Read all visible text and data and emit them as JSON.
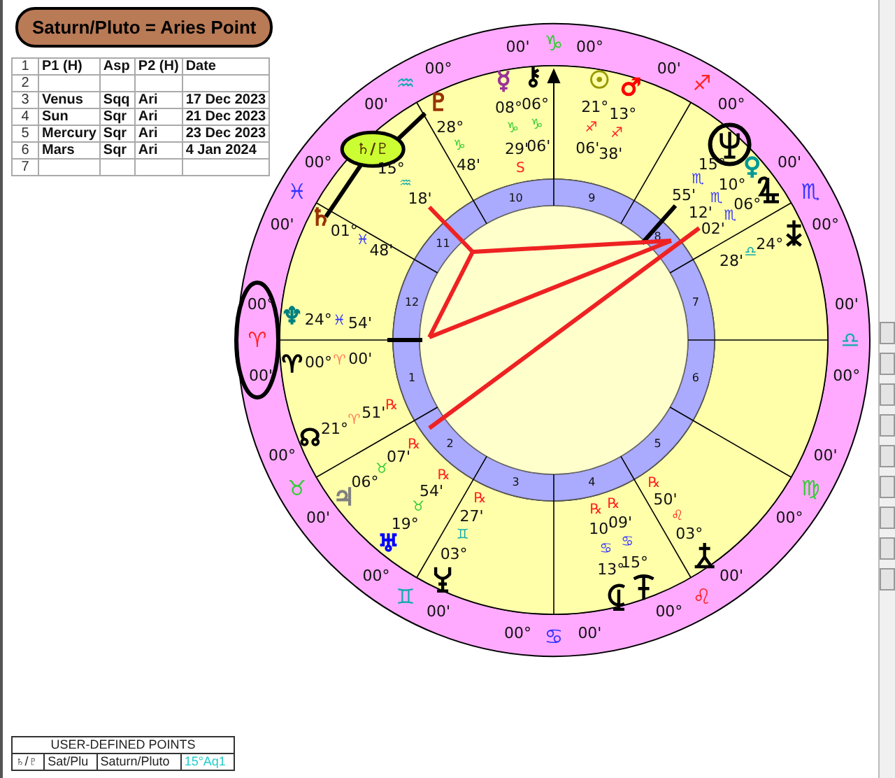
{
  "title": "Saturn/Pluto = Aries Point",
  "table": {
    "header": {
      "number": "1",
      "cells": [
        "P1 (H)",
        "Asp",
        "P2 (H)",
        "Date"
      ]
    },
    "rows": [
      {
        "number": "2",
        "cells": []
      },
      {
        "number": "3",
        "cells": [
          "Venus",
          "Sqq",
          "Ari",
          "17 Dec 2023"
        ]
      },
      {
        "number": "4",
        "cells": [
          "Sun",
          "Sqr",
          "Ari",
          "21 Dec 2023"
        ]
      },
      {
        "number": "5",
        "cells": [
          "Mercury",
          "Sqr",
          "Ari",
          "23 Dec 2023"
        ]
      },
      {
        "number": "6",
        "cells": [
          "Mars",
          "Sqr",
          "Ari",
          "4 Jan 2024"
        ]
      },
      {
        "number": "7",
        "cells": []
      }
    ]
  },
  "signs": [
    {
      "glyph": "♑",
      "degree": "00°",
      "minute": "00'",
      "color": "#33cc33",
      "circled": false
    },
    {
      "glyph": "♐",
      "degree": "00°",
      "minute": "00'",
      "color": "#ff2222",
      "circled": false
    },
    {
      "glyph": "♏",
      "degree": "00°",
      "minute": "00'",
      "color": "#3333ff",
      "circled": false
    },
    {
      "glyph": "♎",
      "degree": "00°",
      "minute": "00'",
      "color": "#11aaaa",
      "circled": false
    },
    {
      "glyph": "♍",
      "degree": "00°",
      "minute": "00'",
      "color": "#33cc33",
      "circled": false
    },
    {
      "glyph": "♌",
      "degree": "00°",
      "minute": "00'",
      "color": "#ff2222",
      "circled": false
    },
    {
      "glyph": "♋",
      "degree": "00°",
      "minute": "00'",
      "color": "#3333ff",
      "circled": false
    },
    {
      "glyph": "♊",
      "degree": "00°",
      "minute": "00'",
      "color": "#11aaaa",
      "circled": false
    },
    {
      "glyph": "♉",
      "degree": "00°",
      "minute": "00'",
      "color": "#33cc33",
      "circled": false
    },
    {
      "glyph": "♈",
      "degree": "00°",
      "minute": "00'",
      "color": "#ff2222",
      "circled": true
    },
    {
      "glyph": "♓",
      "degree": "00°",
      "minute": "00'",
      "color": "#3333ff",
      "circled": false
    },
    {
      "glyph": "♒",
      "degree": "00°",
      "minute": "00'",
      "color": "#11aaaa",
      "circled": false
    }
  ],
  "houses": [
    "1",
    "2",
    "3",
    "4",
    "5",
    "6",
    "7",
    "8",
    "9",
    "10",
    "11",
    "12"
  ],
  "planets": [
    {
      "kind": "glyph",
      "glyph": "☿",
      "color": "#993399",
      "degree": "08°",
      "sign": {
        "glyph": "♑",
        "color": "#33cc33"
      },
      "minute": "29'",
      "motion": "S",
      "circled": false
    },
    {
      "kind": "glyph",
      "glyph": "⚷",
      "color": "#000000",
      "degree": "06°",
      "sign": {
        "glyph": "♑",
        "color": "#33cc33"
      },
      "minute": "06'",
      "circled": false
    },
    {
      "kind": "glyph",
      "glyph": "☉",
      "color": "#999900",
      "degree": "21°",
      "sign": {
        "glyph": "♐",
        "color": "#ff2222"
      },
      "minute": "06'",
      "circled": false
    },
    {
      "kind": "glyph",
      "glyph": "♂",
      "color": "#ff0000",
      "degree": "13°",
      "sign": {
        "glyph": "♐",
        "color": "#ff2222"
      },
      "minute": "38'",
      "circled": false
    },
    {
      "kind": "glyph",
      "glyph": "♇",
      "color": "#993300",
      "degree": "28°",
      "sign": {
        "glyph": "♑",
        "color": "#33cc33"
      },
      "minute": "48'",
      "circled": false
    },
    {
      "kind": "midpoint",
      "glyph": "♄/♇",
      "color": "#ccff33",
      "degree": "15°",
      "sign": {
        "glyph": "♒",
        "color": "#11aaaa"
      },
      "minute": "18'",
      "circled": false
    },
    {
      "kind": "glyph",
      "glyph": "♄",
      "color": "#993300",
      "degree": "01°",
      "sign": {
        "glyph": "♓",
        "color": "#3333ff"
      },
      "minute": "48'",
      "circled": false
    },
    {
      "kind": "symbol",
      "degree": "15°",
      "sign": {
        "glyph": "♏",
        "color": "#3333ff"
      },
      "minute": "55'",
      "circled": true
    },
    {
      "kind": "glyph",
      "glyph": "♀",
      "color": "#009999",
      "degree": "10°",
      "sign": {
        "glyph": "♏",
        "color": "#3333ff"
      },
      "minute": "12'",
      "circled": false
    },
    {
      "kind": "symbol",
      "degree": "06°",
      "sign": {
        "glyph": "♏",
        "color": "#3333ff"
      },
      "minute": "02'",
      "circled": false
    },
    {
      "kind": "symbol",
      "degree": "24°",
      "sign": {
        "glyph": "♎",
        "color": "#11aaaa"
      },
      "minute": "28'",
      "circled": false
    },
    {
      "kind": "glyph",
      "glyph": "♆",
      "color": "#008080",
      "degree": "24°",
      "sign": {
        "glyph": "♓",
        "color": "#3333ff"
      },
      "minute": "54'",
      "circled": false
    },
    {
      "kind": "glyph",
      "glyph": "♈",
      "color": "#000000",
      "degree": "00°",
      "sign": {
        "glyph": "♈",
        "color": "#ff7755"
      },
      "minute": "00'",
      "circled": false
    },
    {
      "kind": "glyph",
      "glyph": "☊",
      "color": "#000000",
      "degree": "21°",
      "sign": {
        "glyph": "♈",
        "color": "#ff7755"
      },
      "minute": "51'",
      "motion": "℞",
      "circled": false
    },
    {
      "kind": "glyph",
      "glyph": "♃",
      "color": "#808080",
      "degree": "06°",
      "sign": {
        "glyph": "♉",
        "color": "#33cc33"
      },
      "minute": "07'",
      "motion": "℞",
      "circled": false
    },
    {
      "kind": "glyph",
      "glyph": "♅",
      "color": "#0000ff",
      "degree": "19°",
      "sign": {
        "glyph": "♉",
        "color": "#33cc33"
      },
      "minute": "54'",
      "motion": "℞",
      "circled": false
    },
    {
      "kind": "symbol",
      "degree": "03°",
      "sign": {
        "glyph": "♊",
        "color": "#11aaaa"
      },
      "minute": "27'",
      "motion": "℞",
      "circled": false
    },
    {
      "kind": "symbol",
      "degree": "13°",
      "sign": {
        "glyph": "♋",
        "color": "#3333ff"
      },
      "minute": "10'",
      "motion": "℞",
      "circled": false
    },
    {
      "kind": "symbol",
      "degree": "15°",
      "sign": {
        "glyph": "♋",
        "color": "#3333ff"
      },
      "minute": "09'",
      "motion": "℞",
      "circled": false
    },
    {
      "kind": "symbol",
      "degree": "03°",
      "sign": {
        "glyph": "♌",
        "color": "#ff2222"
      },
      "minute": "50'",
      "motion": "℞",
      "circled": false
    }
  ],
  "user_points": {
    "title": "USER-DEFINED POINTS",
    "row": [
      "♄/♇",
      "Sat/Plu",
      "Saturn/Pluto",
      "15°Aq1"
    ]
  }
}
